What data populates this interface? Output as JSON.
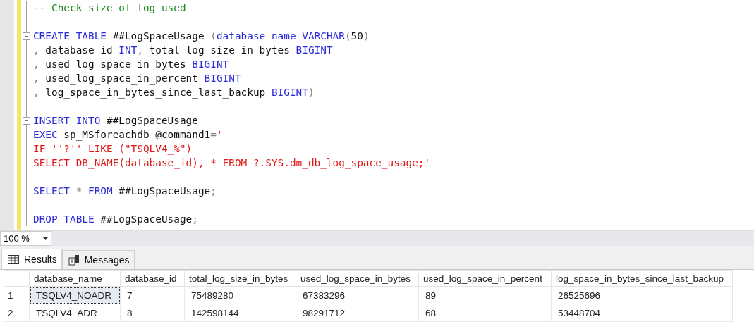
{
  "editor": {
    "lines": [
      {
        "kind": "code",
        "tokens": [
          {
            "text": "-- Check size of log used",
            "kind": "comment"
          }
        ]
      },
      {
        "kind": "blank"
      },
      {
        "kind": "block",
        "tokens": [
          {
            "text": "CREATE TABLE",
            "kind": "keyword"
          },
          {
            "text": " ##LogSpaceUsage ",
            "kind": "plain"
          },
          {
            "text": "(",
            "kind": "punct"
          },
          {
            "text": "database_name ",
            "kind": "keyword"
          },
          {
            "text": "VARCHAR",
            "kind": "keyword"
          },
          {
            "text": "(",
            "kind": "punct"
          },
          {
            "text": "50",
            "kind": "plain"
          },
          {
            "text": ")",
            "kind": "punct"
          }
        ]
      },
      {
        "kind": "code",
        "tokens": [
          {
            "text": ",",
            "kind": "punct"
          },
          {
            "text": " database_id ",
            "kind": "plain"
          },
          {
            "text": "INT",
            "kind": "keyword"
          },
          {
            "text": ",",
            "kind": "punct"
          },
          {
            "text": " total_log_size_in_bytes ",
            "kind": "plain"
          },
          {
            "text": "BIGINT",
            "kind": "keyword"
          }
        ]
      },
      {
        "kind": "code",
        "tokens": [
          {
            "text": ",",
            "kind": "punct"
          },
          {
            "text": " used_log_space_in_bytes ",
            "kind": "plain"
          },
          {
            "text": "BIGINT",
            "kind": "keyword"
          }
        ]
      },
      {
        "kind": "code",
        "tokens": [
          {
            "text": ",",
            "kind": "punct"
          },
          {
            "text": " used_log_space_in_percent ",
            "kind": "plain"
          },
          {
            "text": "BIGINT",
            "kind": "keyword"
          }
        ]
      },
      {
        "kind": "code",
        "tokens": [
          {
            "text": ",",
            "kind": "punct"
          },
          {
            "text": " log_space_in_bytes_since_last_backup ",
            "kind": "plain"
          },
          {
            "text": "BIGINT",
            "kind": "keyword"
          },
          {
            "text": ")",
            "kind": "punct"
          }
        ]
      },
      {
        "kind": "blank"
      },
      {
        "kind": "block",
        "tokens": [
          {
            "text": "INSERT INTO",
            "kind": "keyword"
          },
          {
            "text": " ##LogSpaceUsage",
            "kind": "plain"
          }
        ]
      },
      {
        "kind": "code",
        "tokens": [
          {
            "text": "EXEC",
            "kind": "keyword"
          },
          {
            "text": " sp_MSforeachdb @command1",
            "kind": "plain"
          },
          {
            "text": "=",
            "kind": "punct"
          },
          {
            "text": "'",
            "kind": "string"
          }
        ]
      },
      {
        "kind": "code",
        "tokens": [
          {
            "text": "IF ''?'' LIKE (\"TSQLV4_%\")",
            "kind": "string"
          }
        ]
      },
      {
        "kind": "code",
        "tokens": [
          {
            "text": "SELECT DB_NAME(database_id), * FROM ?.SYS.dm_db_log_space_usage;'",
            "kind": "string"
          }
        ]
      },
      {
        "kind": "blank"
      },
      {
        "kind": "code",
        "tokens": [
          {
            "text": "SELECT",
            "kind": "keyword"
          },
          {
            "text": " * ",
            "kind": "punct"
          },
          {
            "text": "FROM",
            "kind": "keyword"
          },
          {
            "text": " ##LogSpaceUsage",
            "kind": "plain"
          },
          {
            "text": ";",
            "kind": "punct"
          }
        ]
      },
      {
        "kind": "blank"
      },
      {
        "kind": "code",
        "tokens": [
          {
            "text": "DROP TABLE",
            "kind": "keyword"
          },
          {
            "text": " ##LogSpaceUsage",
            "kind": "plain"
          },
          {
            "text": ";",
            "kind": "punct"
          }
        ]
      }
    ]
  },
  "zoom": {
    "value": "100 %"
  },
  "tabs": [
    {
      "label": "Results",
      "selected": true,
      "kind": "grid"
    },
    {
      "label": "Messages",
      "selected": false,
      "kind": "messages"
    }
  ],
  "results": {
    "columns": [
      "database_name",
      "database_id",
      "total_log_size_in_bytes",
      "used_log_space_in_bytes",
      "used_log_space_in_percent",
      "log_space_in_bytes_since_last_backup"
    ],
    "rows": [
      {
        "number": "1",
        "cells": [
          {
            "text": "TSQLV4_NOADR",
            "selected": true
          },
          {
            "text": "7",
            "selected": false
          },
          {
            "text": "75489280",
            "selected": false
          },
          {
            "text": "67383296",
            "selected": false
          },
          {
            "text": "89",
            "selected": false
          },
          {
            "text": "26525696",
            "selected": false
          }
        ]
      },
      {
        "number": "2",
        "cells": [
          {
            "text": "TSQLV4_ADR",
            "selected": false
          },
          {
            "text": "8",
            "selected": false
          },
          {
            "text": "142598144",
            "selected": false
          },
          {
            "text": "98291712",
            "selected": false
          },
          {
            "text": "68",
            "selected": false
          },
          {
            "text": "53448704",
            "selected": false
          }
        ]
      }
    ]
  }
}
